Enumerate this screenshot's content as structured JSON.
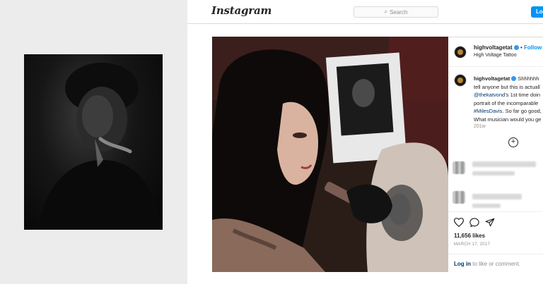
{
  "app": {
    "logo": "Instagram"
  },
  "search": {
    "placeholder": "Search",
    "icon": "search-icon"
  },
  "header_actions": {
    "login_label": "Log"
  },
  "post": {
    "username": "highvoltagetat",
    "follow_separator": "•",
    "follow_label": "Follow",
    "subtitle": "High Voltage Tattoo",
    "caption": {
      "username": "highvoltagetat",
      "line1": "Shhhhhh",
      "line2": "tell anyone but this is actuall",
      "line3_mention": "@thekatvond",
      "line3_rest": "'s 1st time doin",
      "line4": "portrait of the incomparable",
      "line5_hashtag": "#MilesDavis",
      "line5_rest": ". So far go good,",
      "line6": "What musician would you ge"
    },
    "time_ago": "201w",
    "likes": "11,656 likes",
    "date": "MARCH 17, 2017",
    "login_link": "Log in",
    "login_rest": " to like or comment."
  },
  "icons": {
    "verified": "verified-badge-icon",
    "load_more": "plus-circle-icon",
    "like": "heart-icon",
    "comment": "comment-icon",
    "share": "share-icon"
  },
  "colors": {
    "accent": "#0095f6",
    "link": "#00376b",
    "muted": "#8e8e8e",
    "text": "#262626",
    "verified": "#3897f0"
  }
}
